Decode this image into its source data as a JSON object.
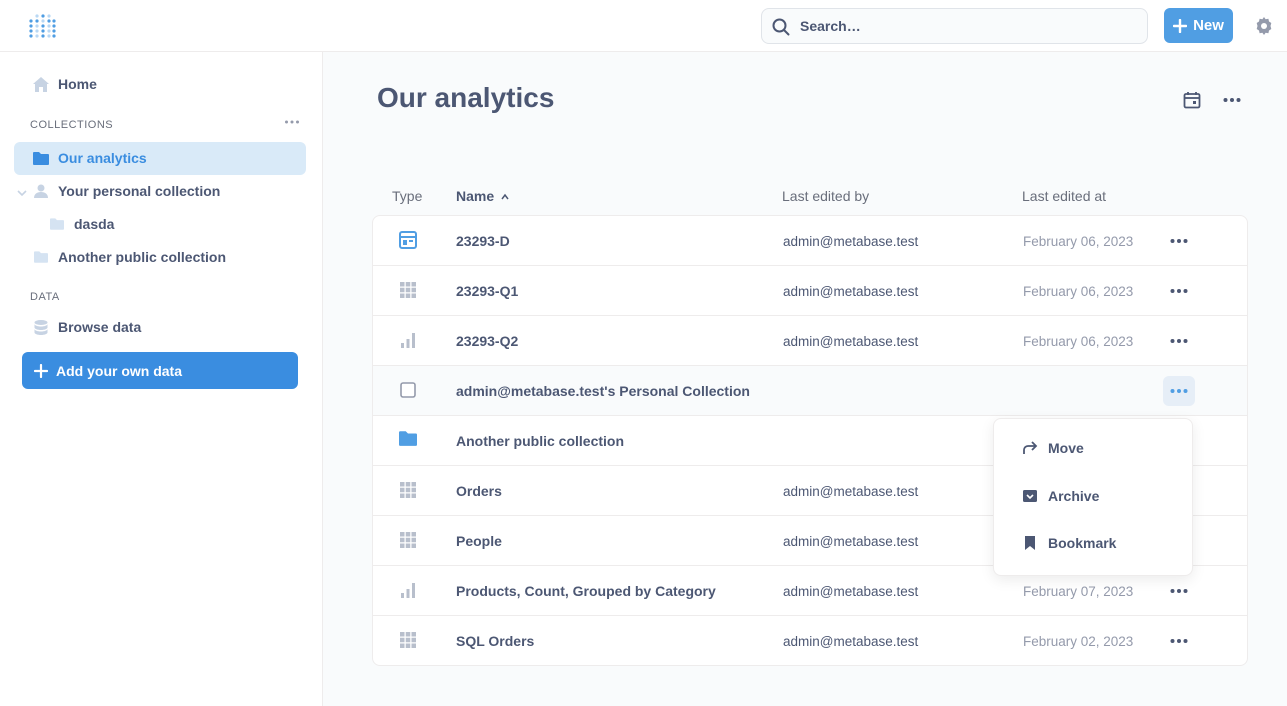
{
  "topbar": {
    "logo_icon": "metabase-logo-icon",
    "search_placeholder": "Search…",
    "new_label": "New",
    "accent_color": "#509ee3"
  },
  "sidebar": {
    "home_label": "Home",
    "collections_label": "COLLECTIONS",
    "collections": [
      {
        "label": "Our analytics"
      },
      {
        "label": "Your personal collection"
      },
      {
        "label": "dasda"
      },
      {
        "label": "Another public collection"
      }
    ],
    "data_label": "DATA",
    "browse_label": "Browse data",
    "add_data_label": "Add your own data"
  },
  "main": {
    "title": "Our analytics",
    "columns": {
      "type": "Type",
      "name": "Name",
      "last_edited_by": "Last edited by",
      "last_edited_at": "Last edited at"
    },
    "rows": [
      {
        "type_icon": "dashboard-icon",
        "name": "23293-D",
        "by": "admin@metabase.test",
        "at": "February 06, 2023"
      },
      {
        "type_icon": "table-icon",
        "name": "23293-Q1",
        "by": "admin@metabase.test",
        "at": "February 06, 2023"
      },
      {
        "type_icon": "bar-chart-icon",
        "name": "23293-Q2",
        "by": "admin@metabase.test",
        "at": "February 06, 2023"
      },
      {
        "type_icon": "checkbox-icon",
        "name": "admin@metabase.test's Personal Collection",
        "by": "",
        "at": ""
      },
      {
        "type_icon": "folder-icon",
        "name": "Another public collection",
        "by": "",
        "at": ""
      },
      {
        "type_icon": "table-icon",
        "name": "Orders",
        "by": "admin@metabase.test",
        "at": ""
      },
      {
        "type_icon": "table-icon",
        "name": "People",
        "by": "admin@metabase.test",
        "at": ""
      },
      {
        "type_icon": "bar-chart-icon",
        "name": "Products, Count, Grouped by Category",
        "by": "admin@metabase.test",
        "at": "February 07, 2023"
      },
      {
        "type_icon": "table-icon",
        "name": "SQL Orders",
        "by": "admin@metabase.test",
        "at": "February 02, 2023"
      }
    ]
  },
  "popover": {
    "items": [
      {
        "label": "Move",
        "icon": "move-arrow-icon"
      },
      {
        "label": "Archive",
        "icon": "archive-icon"
      },
      {
        "label": "Bookmark",
        "icon": "bookmark-icon"
      }
    ]
  }
}
